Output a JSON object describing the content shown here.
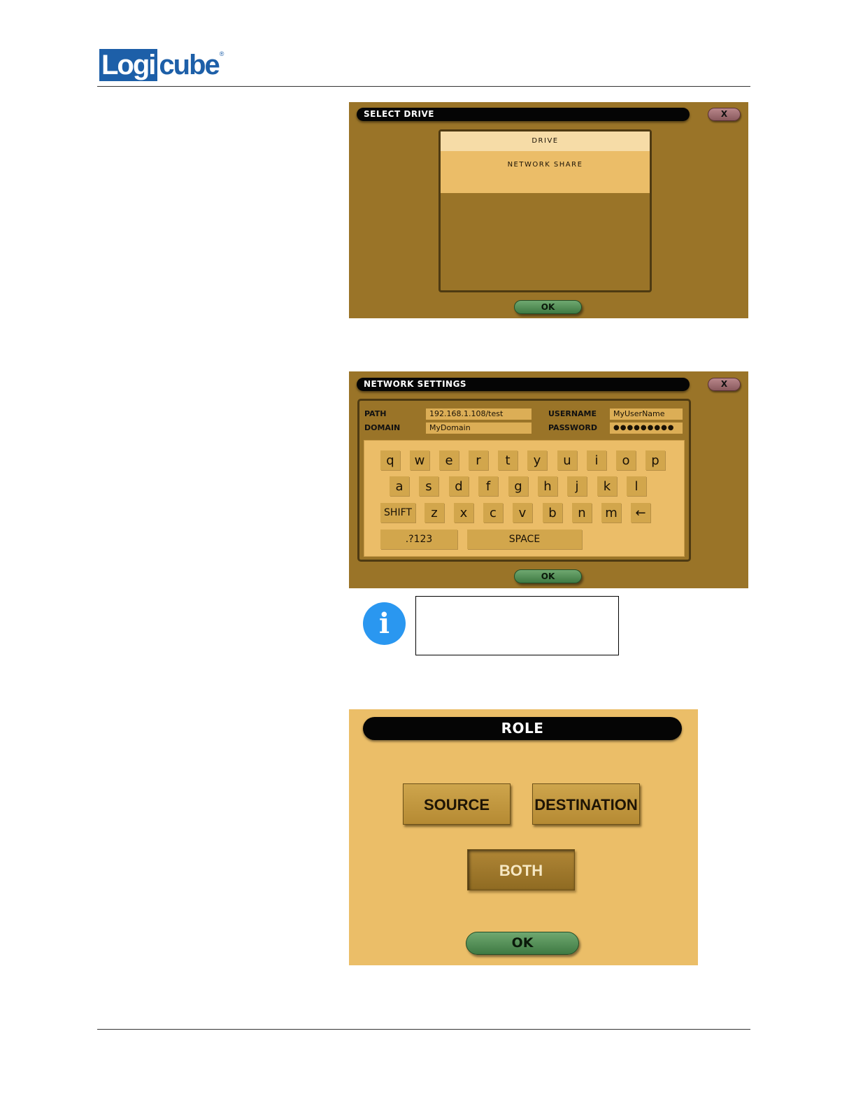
{
  "header": {
    "logo_boxed": "Logi",
    "logo_rest": "cube",
    "logo_reg": "®"
  },
  "select_drive": {
    "title": "SELECT DRIVE",
    "close_label": "X",
    "items": [
      "DRIVE",
      "NETWORK SHARE"
    ],
    "selected_index": 0,
    "ok_label": "OK"
  },
  "network_settings": {
    "title": "NETWORK SETTINGS",
    "close_label": "X",
    "path_label": "PATH",
    "path_value": "192.168.1.108/test",
    "domain_label": "DOMAIN",
    "domain_value": "MyDomain",
    "username_label": "USERNAME",
    "username_value": "MyUserName",
    "password_label": "PASSWORD",
    "password_value": "●●●●●●●●●",
    "keyboard": {
      "row1": [
        "q",
        "w",
        "e",
        "r",
        "t",
        "y",
        "u",
        "i",
        "o",
        "p"
      ],
      "row2": [
        "a",
        "s",
        "d",
        "f",
        "g",
        "h",
        "j",
        "k",
        "l"
      ],
      "shift": "SHIFT",
      "row3": [
        "z",
        "x",
        "c",
        "v",
        "b",
        "n",
        "m"
      ],
      "backspace": "←",
      "symbols": ".?123",
      "space": "SPACE"
    },
    "ok_label": "OK"
  },
  "info_note": {
    "icon": "info-icon",
    "icon_glyph": "i"
  },
  "role": {
    "title": "ROLE",
    "source_label": "SOURCE",
    "destination_label": "DESTINATION",
    "both_label": "BOTH",
    "selected": "BOTH",
    "ok_label": "OK"
  },
  "colors": {
    "screen_bg": "#9a7428",
    "list_selected": "#f6dca7",
    "key_bg": "#d2a64c",
    "ok_green": "#4f8a52",
    "info_blue": "#2a97f0",
    "logo_blue": "#1d5fa8"
  }
}
